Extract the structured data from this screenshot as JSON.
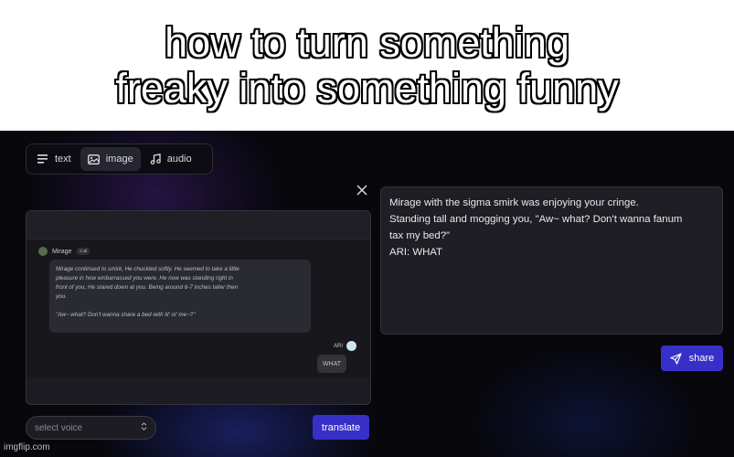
{
  "caption": "how to turn something\nfreaky into something funny",
  "tabs": [
    {
      "label": "text",
      "icon": "text-lines-icon"
    },
    {
      "label": "image",
      "icon": "image-icon",
      "active": true
    },
    {
      "label": "audio",
      "icon": "music-note-icon"
    }
  ],
  "input_image": {
    "sender_name": "Mirage",
    "sender_badge": "c.ai",
    "message": "Mirage continued to smirk, He chuckled softly. He seemed to take a little\npleasure in how embarrassed you were. He now was standing right in\nfront of you, He stared down at you. Being around 6-7 inches taller then\nyou.\n\n\"Aw~ what? Don't wanna share a bed with lil' ol' me~?\"",
    "reply_name": "ARI",
    "reply_text": "WHAT"
  },
  "output": {
    "text": "Mirage with the sigma smirk was enjoying your cringe.\nStanding tall and mogging you, \"Aw~ what? Don't wanna fanum\ntax my bed?\"\nARI: WHAT"
  },
  "buttons": {
    "share": "share",
    "translate": "translate"
  },
  "voice_select": {
    "placeholder": "select voice"
  },
  "watermark": "imgflip.com",
  "colors": {
    "accent": "#3730c8",
    "background": "#07070c",
    "panel": "#1e1e24"
  }
}
